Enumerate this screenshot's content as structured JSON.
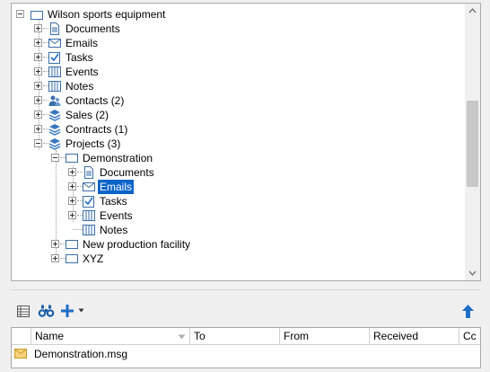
{
  "tree": {
    "root": {
      "label": "Wilson sports equipment"
    },
    "items": [
      {
        "label": "Documents"
      },
      {
        "label": "Emails"
      },
      {
        "label": "Tasks"
      },
      {
        "label": "Events"
      },
      {
        "label": "Notes"
      },
      {
        "label": "Contacts (2)"
      },
      {
        "label": "Sales (2)"
      },
      {
        "label": "Contracts (1)"
      },
      {
        "label": "Projects (3)"
      }
    ],
    "projects": [
      {
        "label": "Demonstration"
      },
      {
        "label": "New production facility"
      },
      {
        "label": "XYZ"
      }
    ],
    "demonstration_children": [
      {
        "label": "Documents"
      },
      {
        "label": "Emails",
        "selected": true
      },
      {
        "label": "Tasks"
      },
      {
        "label": "Events"
      },
      {
        "label": "Notes"
      }
    ]
  },
  "toolbar": {
    "icons": [
      "table-icon",
      "binoculars-icon",
      "add-icon",
      "upload-arrow-icon"
    ]
  },
  "grid": {
    "columns": [
      {
        "label": "Name"
      },
      {
        "label": "To"
      },
      {
        "label": "From"
      },
      {
        "label": "Received"
      },
      {
        "label": "Cc"
      }
    ],
    "rows": [
      {
        "name": "Demonstration.msg"
      }
    ]
  },
  "colors": {
    "selection": "#0a64c8",
    "accent": "#1e6ec8"
  }
}
